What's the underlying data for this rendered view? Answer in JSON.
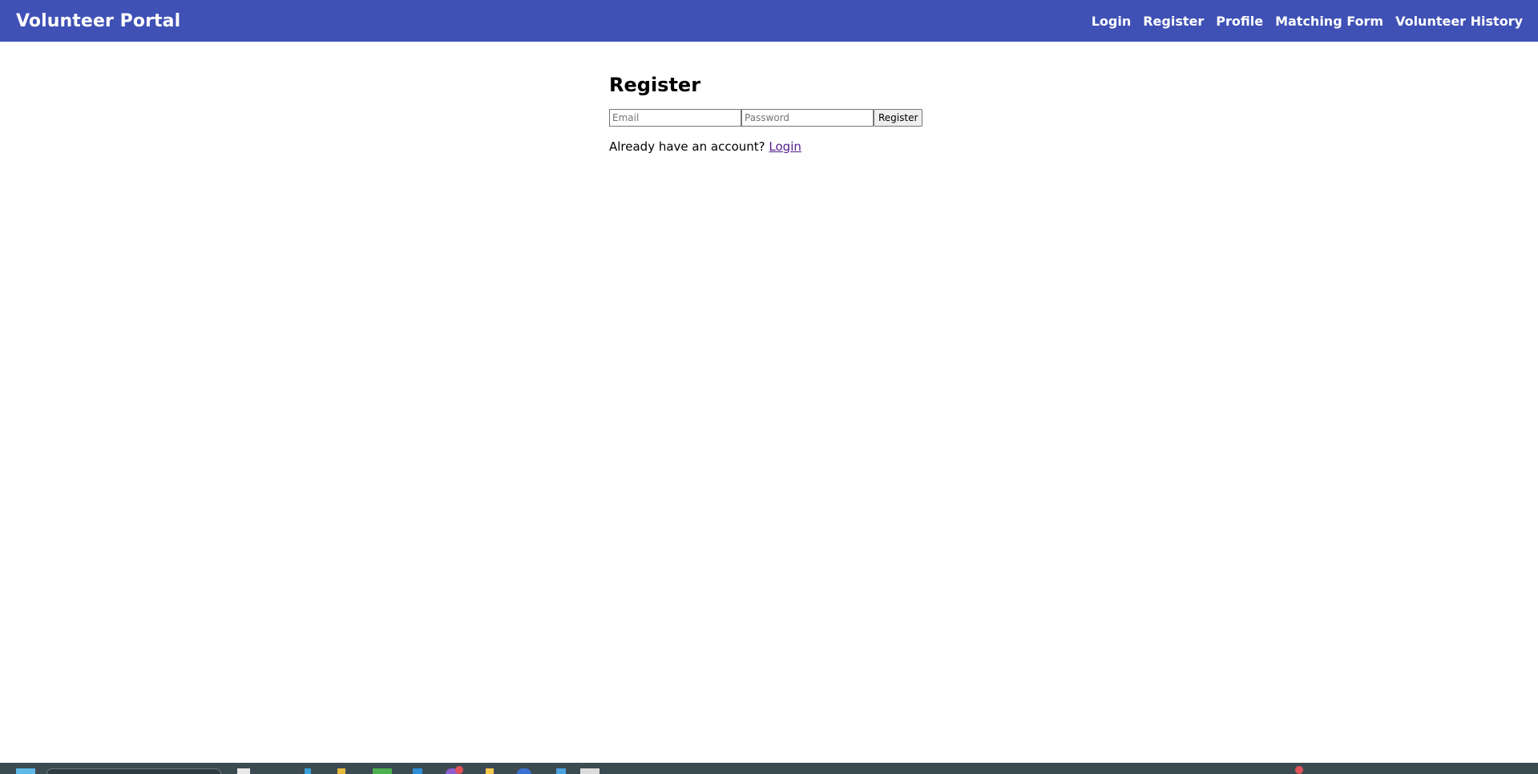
{
  "navbar": {
    "brand": "Volunteer Portal",
    "links": [
      {
        "label": "Login"
      },
      {
        "label": "Register"
      },
      {
        "label": "Profile"
      },
      {
        "label": "Matching Form"
      },
      {
        "label": "Volunteer History"
      }
    ],
    "background_color": "#3f51b5"
  },
  "main": {
    "title": "Register",
    "email_placeholder": "Email",
    "password_placeholder": "Password",
    "submit_label": "Register",
    "account_prompt": "Already have an account?",
    "login_link": "Login"
  },
  "taskbar": {
    "background_color": "#3c4a52",
    "icons": [
      "start-icon",
      "search-box",
      "task-view-icon",
      "edge-icon",
      "file-explorer-icon",
      "excel-icon",
      "store-icon",
      "chrome-icon",
      "drive-icon",
      "browser-icon",
      "app-icon",
      "notepad-icon"
    ]
  }
}
